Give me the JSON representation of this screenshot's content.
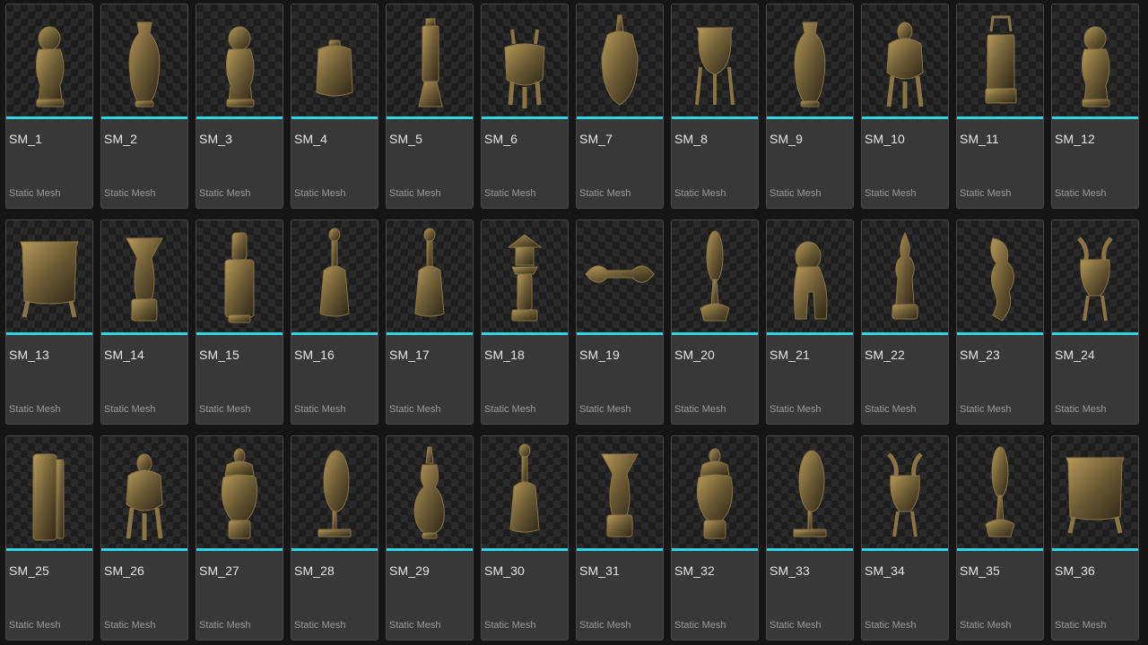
{
  "asset_type_color": "#2ed6e6",
  "tiles": [
    {
      "name": "SM_1",
      "type": "Static Mesh",
      "icon": "figurine-icon"
    },
    {
      "name": "SM_2",
      "type": "Static Mesh",
      "icon": "tall-vase-icon"
    },
    {
      "name": "SM_3",
      "type": "Static Mesh",
      "icon": "figurine-icon"
    },
    {
      "name": "SM_4",
      "type": "Static Mesh",
      "icon": "stump-jar-icon"
    },
    {
      "name": "SM_5",
      "type": "Static Mesh",
      "icon": "plaque-stand-icon"
    },
    {
      "name": "SM_6",
      "type": "Static Mesh",
      "icon": "censer-icon"
    },
    {
      "name": "SM_7",
      "type": "Static Mesh",
      "icon": "mask-head-icon"
    },
    {
      "name": "SM_8",
      "type": "Static Mesh",
      "icon": "tripod-cauldron-icon"
    },
    {
      "name": "SM_9",
      "type": "Static Mesh",
      "icon": "tall-vase-icon"
    },
    {
      "name": "SM_10",
      "type": "Static Mesh",
      "icon": "lidded-censer-icon"
    },
    {
      "name": "SM_11",
      "type": "Static Mesh",
      "icon": "lantern-box-icon"
    },
    {
      "name": "SM_12",
      "type": "Static Mesh",
      "icon": "figurine-icon"
    },
    {
      "name": "SM_13",
      "type": "Static Mesh",
      "icon": "round-pot-icon"
    },
    {
      "name": "SM_14",
      "type": "Static Mesh",
      "icon": "goblet-vase-icon"
    },
    {
      "name": "SM_15",
      "type": "Static Mesh",
      "icon": "flat-vase-icon"
    },
    {
      "name": "SM_16",
      "type": "Static Mesh",
      "icon": "bell-icon"
    },
    {
      "name": "SM_17",
      "type": "Static Mesh",
      "icon": "bell-icon"
    },
    {
      "name": "SM_18",
      "type": "Static Mesh",
      "icon": "pagoda-lantern-icon"
    },
    {
      "name": "SM_19",
      "type": "Static Mesh",
      "icon": "vajra-icon"
    },
    {
      "name": "SM_20",
      "type": "Static Mesh",
      "icon": "mirror-stand-icon"
    },
    {
      "name": "SM_21",
      "type": "Static Mesh",
      "icon": "lion-icon"
    },
    {
      "name": "SM_22",
      "type": "Static Mesh",
      "icon": "flame-urn-icon"
    },
    {
      "name": "SM_23",
      "type": "Static Mesh",
      "icon": "dragon-icon"
    },
    {
      "name": "SM_24",
      "type": "Static Mesh",
      "icon": "horned-vessel-icon"
    },
    {
      "name": "SM_25",
      "type": "Static Mesh",
      "icon": "stele-icon"
    },
    {
      "name": "SM_26",
      "type": "Static Mesh",
      "icon": "lidded-censer-icon"
    },
    {
      "name": "SM_27",
      "type": "Static Mesh",
      "icon": "lidded-urn-icon"
    },
    {
      "name": "SM_28",
      "type": "Static Mesh",
      "icon": "disc-stand-icon"
    },
    {
      "name": "SM_29",
      "type": "Static Mesh",
      "icon": "ewer-icon"
    },
    {
      "name": "SM_30",
      "type": "Static Mesh",
      "icon": "bell-icon"
    },
    {
      "name": "SM_31",
      "type": "Static Mesh",
      "icon": "goblet-vase-icon"
    },
    {
      "name": "SM_32",
      "type": "Static Mesh",
      "icon": "lidded-urn-icon"
    },
    {
      "name": "SM_33",
      "type": "Static Mesh",
      "icon": "disc-stand-icon"
    },
    {
      "name": "SM_34",
      "type": "Static Mesh",
      "icon": "horned-vessel-icon"
    },
    {
      "name": "SM_35",
      "type": "Static Mesh",
      "icon": "mirror-stand-icon"
    },
    {
      "name": "SM_36",
      "type": "Static Mesh",
      "icon": "round-pot-icon"
    }
  ]
}
